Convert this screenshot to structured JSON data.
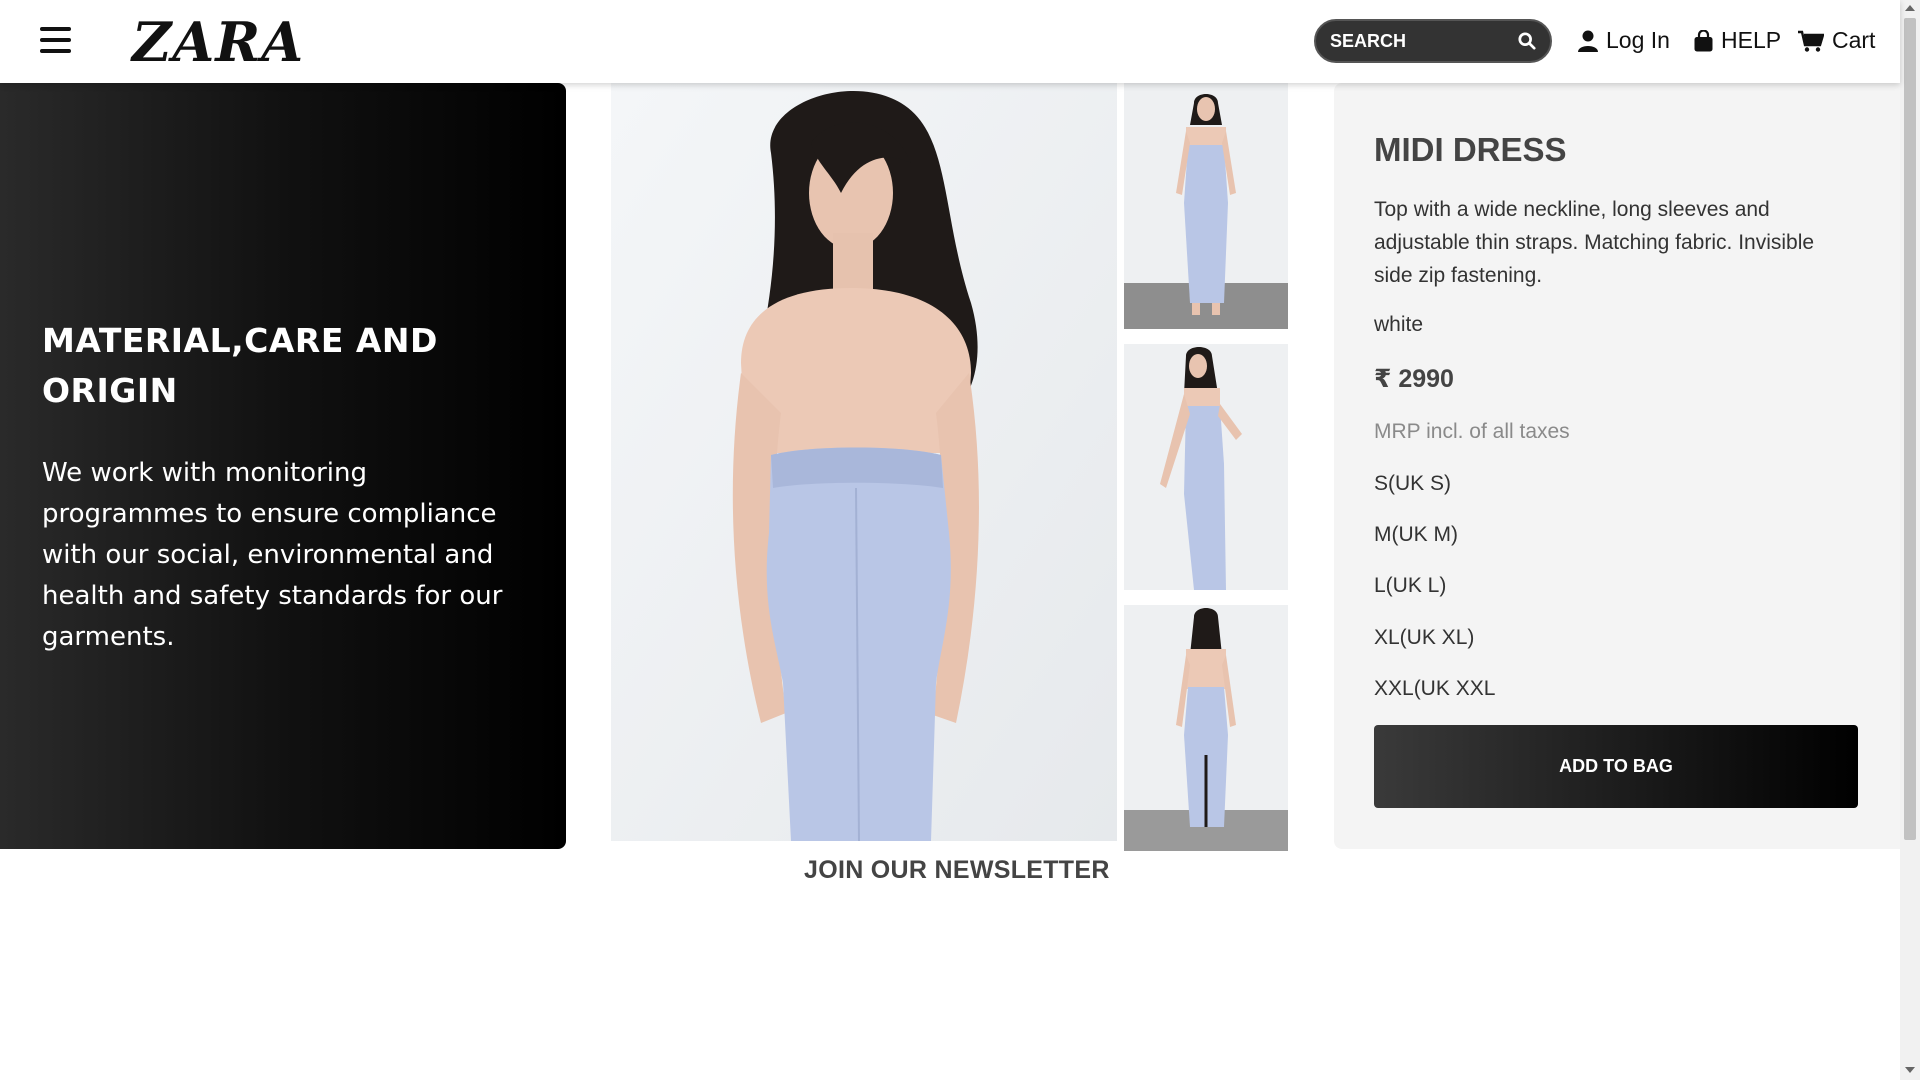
{
  "header": {
    "logo": "ZARA",
    "search_placeholder": "SEARCH",
    "login_label": "Log In",
    "help_label": "HELP",
    "cart_label": "Cart"
  },
  "info": {
    "title": "MATERIAL,CARE AND ORIGIN",
    "text": "We work with monitoring programmes to ensure compliance with our social, environmental and health and safety standards for our garments."
  },
  "product": {
    "title": "MIDI DRESS",
    "description": "Top with a wide neckline, long sleeves and adjustable thin straps. Matching fabric. Invisible side zip fastening.",
    "color": "white",
    "price": "₹ 2990",
    "mrp_note": "MRP incl. of all taxes",
    "sizes": [
      "S(UK S)",
      "M(UK M)",
      "L(UK L)",
      "XL(UK XL)",
      "XXL(UK XXL"
    ],
    "add_to_bag": "ADD TO BAG",
    "dress_color": "#b9c6e6"
  },
  "footer": {
    "newsletter": "JOIN OUR NEWSLETTER"
  }
}
